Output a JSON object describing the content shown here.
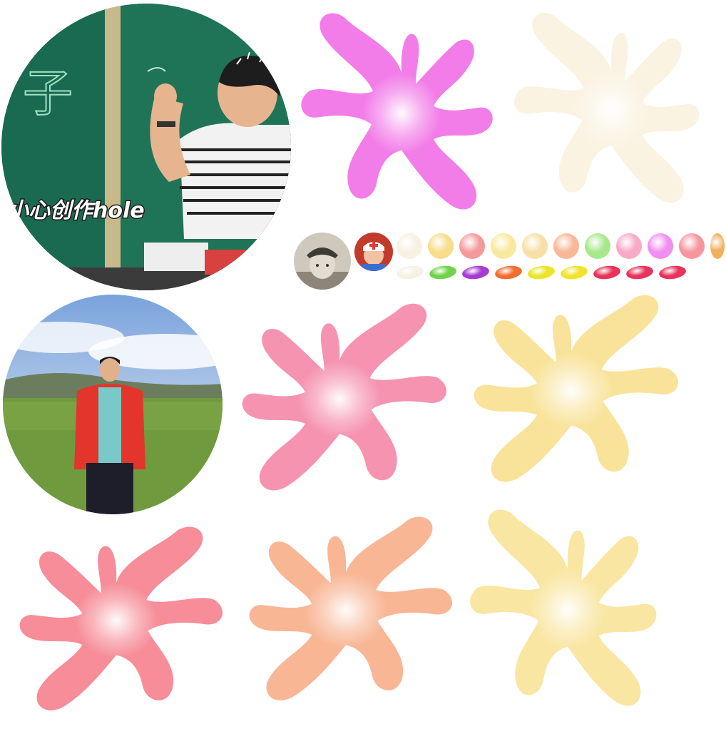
{
  "photos": {
    "classroom": {
      "caption": "小心创作hole",
      "board_char": "子"
    },
    "outdoor": {}
  },
  "avatars": [
    {
      "name": "child-in-cap-avatar"
    },
    {
      "name": "child-nurse-hat-avatar"
    }
  ],
  "dot_colors": [
    "#f7f1e3",
    "#f8dd8a",
    "#f49a9a",
    "#f8ea9c",
    "#f7e0a5",
    "#f8b796",
    "#a8e88c",
    "#f7a9c6",
    "#f28ef0",
    "#f6959d",
    "#f2b05e"
  ],
  "pill_colors": [
    "#f7f1e3",
    "#6fd44a",
    "#a63dd1",
    "#f26d2e",
    "#ece42a",
    "#f2e22a",
    "#e8335a",
    "#e8335a",
    "#e8335a"
  ],
  "splat_colors": {
    "top_middle": "#f27de8",
    "top_right": "#fbf3e2",
    "middle_left": "#f593b0",
    "middle_right": "#f9e39a",
    "bottom_left": "#f68d98",
    "bottom_middle": "#f8b695",
    "bottom_right": "#f9e6a2"
  }
}
